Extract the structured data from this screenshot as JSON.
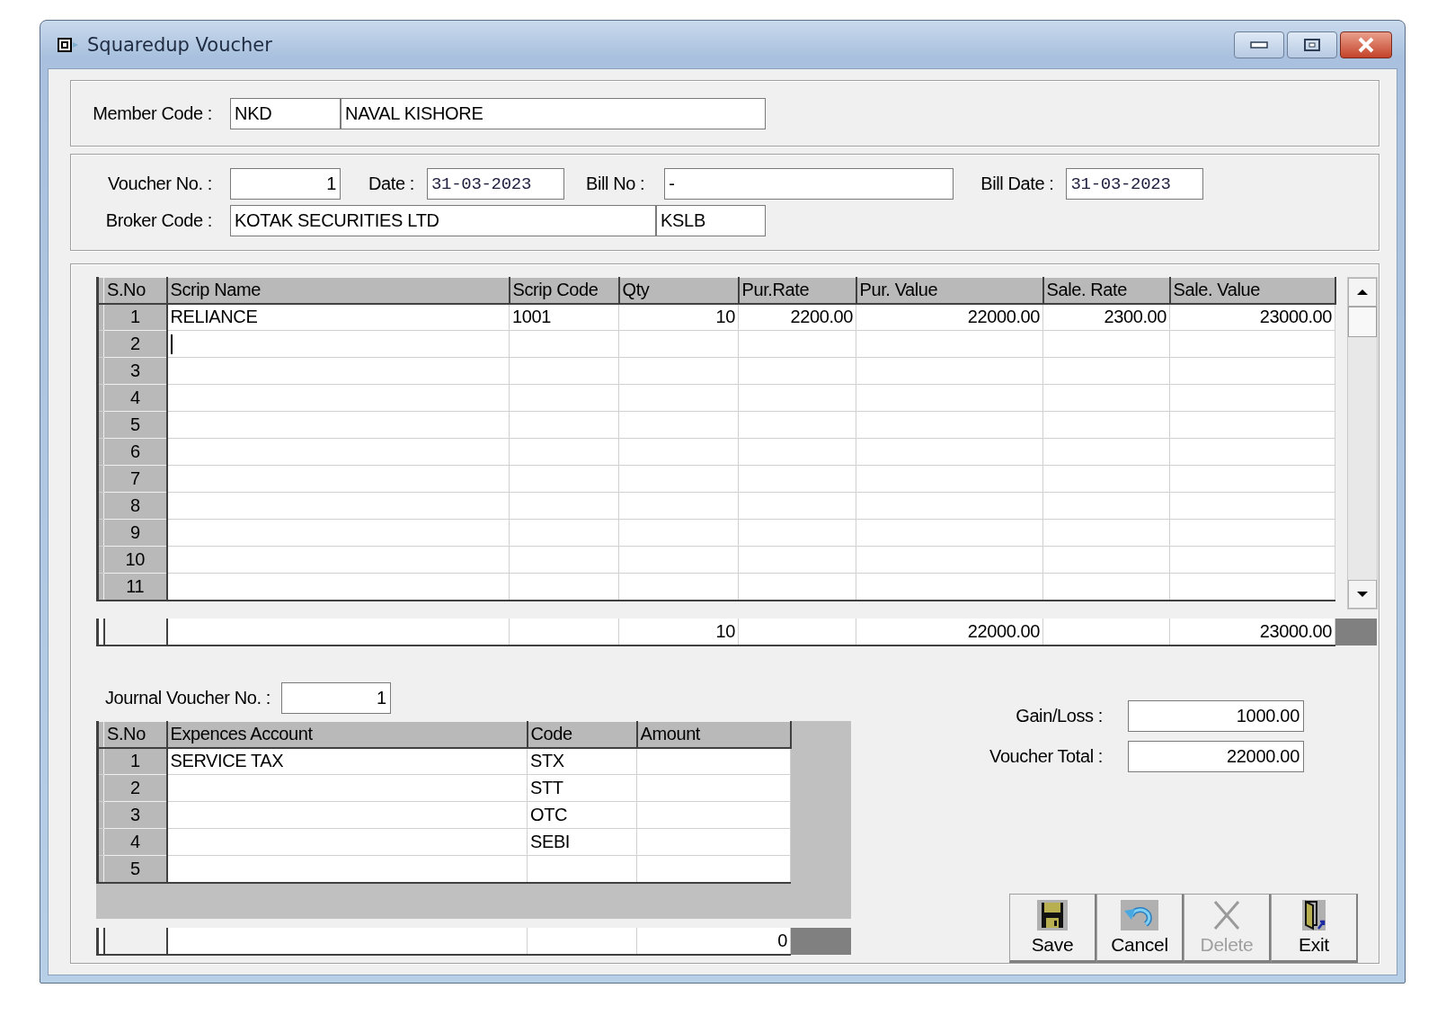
{
  "window": {
    "title": "Squaredup Voucher"
  },
  "member": {
    "label": "Member Code :",
    "code": "NKD",
    "name": "NAVAL KISHORE"
  },
  "voucher": {
    "voucher_no": {
      "label": "Voucher No. :",
      "value": "1"
    },
    "date": {
      "label": "Date :",
      "value": "31-03-2023"
    },
    "bill_no": {
      "label": "Bill No :",
      "value": "-"
    },
    "bill_date": {
      "label": "Bill Date :",
      "value": "31-03-2023"
    },
    "broker": {
      "label": "Broker Code :",
      "name": "KOTAK SECURITIES LTD",
      "code": "KSLB"
    }
  },
  "scrip_grid": {
    "columns": [
      "S.No",
      "Scrip Name",
      "Scrip Code",
      "Qty",
      "Pur.Rate",
      "Pur. Value",
      "Sale. Rate",
      "Sale. Value"
    ],
    "rows": [
      {
        "sno": "1",
        "scrip_name": "RELIANCE",
        "scrip_code": "1001",
        "qty": "10",
        "pur_rate": "2200.00",
        "pur_value": "22000.00",
        "sale_rate": "2300.00",
        "sale_value": "23000.00",
        "editing": false
      },
      {
        "sno": "2",
        "editing": true
      },
      {
        "sno": "3",
        "editing": false
      },
      {
        "sno": "4",
        "editing": false
      },
      {
        "sno": "5",
        "editing": false
      },
      {
        "sno": "6",
        "editing": false
      },
      {
        "sno": "7",
        "editing": false
      },
      {
        "sno": "8",
        "editing": false
      },
      {
        "sno": "9",
        "editing": false
      },
      {
        "sno": "10",
        "editing": false
      },
      {
        "sno": "11",
        "editing": false
      }
    ],
    "totals": {
      "qty": "10",
      "pur_value": "22000.00",
      "sale_value": "23000.00"
    }
  },
  "journal_voucher": {
    "label": "Journal Voucher No. :",
    "value": "1"
  },
  "expense_grid": {
    "columns": [
      "S.No",
      "Expences Account",
      "Code",
      "Amount"
    ],
    "rows": [
      {
        "sno": "1",
        "account": "SERVICE TAX",
        "code": "STX"
      },
      {
        "sno": "2",
        "code": "STT"
      },
      {
        "sno": "3",
        "code": "OTC"
      },
      {
        "sno": "4",
        "code": "SEBI"
      },
      {
        "sno": "5"
      }
    ],
    "totals": {
      "amount": "0"
    }
  },
  "summary": [
    {
      "label": "Gain/Loss :",
      "value": "1000.00"
    },
    {
      "label": "Voucher Total :",
      "value": "22000.00"
    }
  ],
  "buttons": [
    {
      "kind": "save",
      "label": "Save",
      "disabled": false
    },
    {
      "kind": "cancel",
      "label": "Cancel",
      "disabled": false
    },
    {
      "kind": "delete",
      "label": "Delete",
      "disabled": true
    },
    {
      "kind": "exit",
      "label": "Exit",
      "disabled": false
    }
  ]
}
